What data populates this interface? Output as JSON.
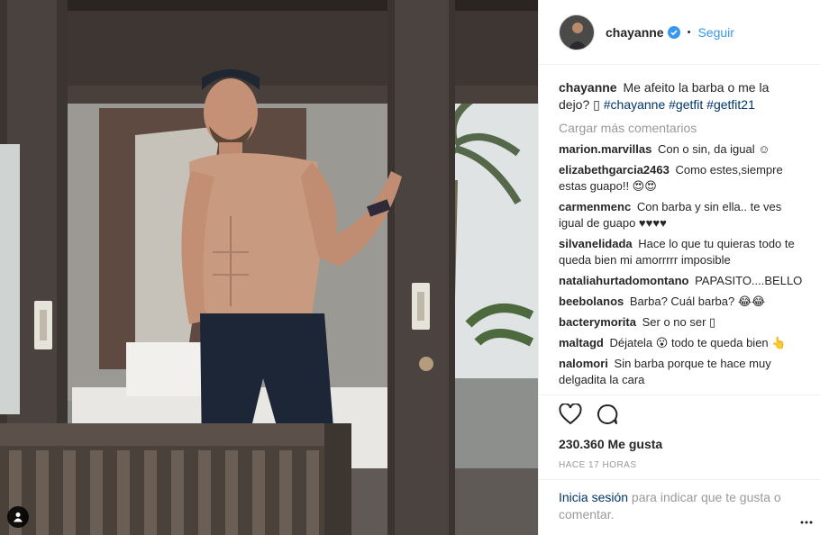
{
  "post": {
    "username": "chayanne",
    "follow_label": "Seguir",
    "dot": "•",
    "caption_text": "Me afeito la barba o me la dejo? ▯ ",
    "caption_tags": "#chayanne #getfit #getfit21",
    "load_more": "Cargar más comentarios",
    "likes": "230.360 Me gusta",
    "time": "HACE 17 HORAS"
  },
  "comments": [
    {
      "user": "marion.marvillas",
      "text": "Con o sin, da igual ☺"
    },
    {
      "user": "elizabethgarcia2463",
      "text": "Como estes,siempre estas guapo!! 😍😍"
    },
    {
      "user": "carmenmenc",
      "text": "Con barba y sin ella.. te ves igual de guapo ♥♥♥♥"
    },
    {
      "user": "silvanelidada",
      "text": "Hace lo que tu quieras todo te queda bien mi amorrrrr imposible"
    },
    {
      "user": "nataliahurtadomontano",
      "text": "PAPASITO....BELLO"
    },
    {
      "user": "beebolanos",
      "text": "Barba? Cuál barba? 😂😂"
    },
    {
      "user": "bacterymorita",
      "text": "Ser o no ser ▯"
    },
    {
      "user": "maltagd",
      "text": "Déjatela 😮 todo te queda bien 👆"
    },
    {
      "user": "nalomori",
      "text": "Sin barba porque te hace muy delgadita la cara"
    }
  ],
  "add_comment": {
    "login": "Inicia sesión",
    "rest": " para indicar que te gusta o comentar."
  },
  "icons": {
    "like": "heart-icon",
    "comment": "comment-icon",
    "verified": "verified-badge-icon",
    "more": "more-options-icon",
    "tag": "user-tag-icon"
  },
  "colors": {
    "link": "#3897f0",
    "hashtag": "#003569",
    "muted": "#999999",
    "text": "#262626"
  }
}
